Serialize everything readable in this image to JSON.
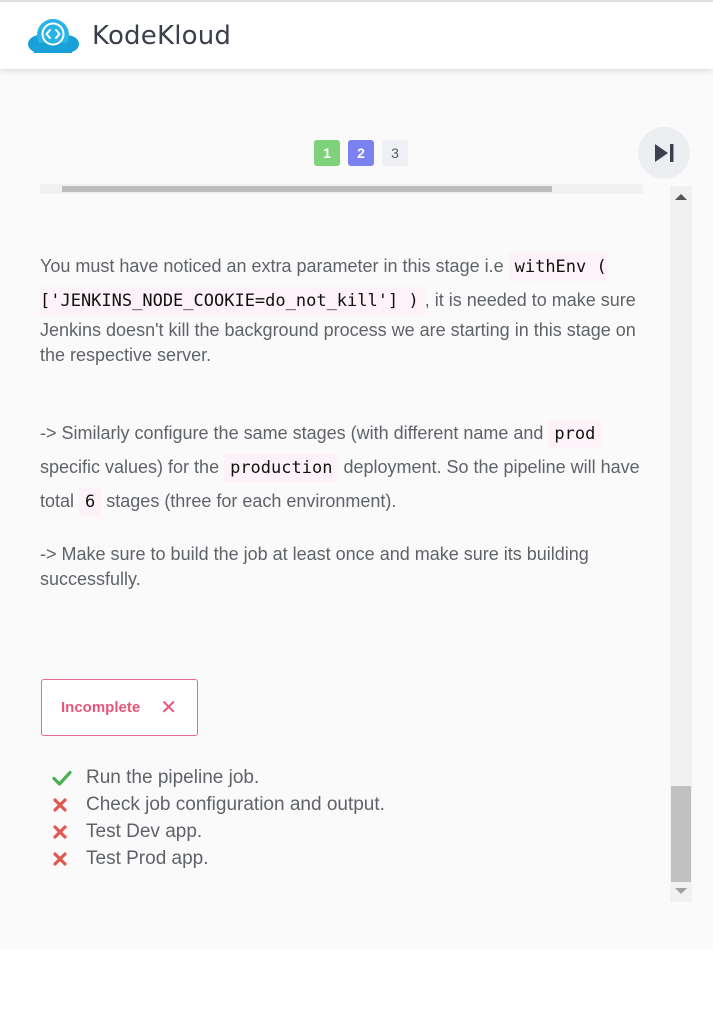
{
  "app": {
    "brand": "KodeKloud",
    "logo_color": "#1fa3dc"
  },
  "pager": {
    "pages": [
      "1",
      "2",
      "3"
    ],
    "current": "2",
    "completed_color": "#7ed27a",
    "current_color": "#7b82f0"
  },
  "content": {
    "p1": {
      "text_before": "You must have noticed an extra parameter in this stage i.e ",
      "code": "withEnv ( ['JENKINS_NODE_COOKIE=do_not_kill'] )",
      "text_after": ", it is needed to make sure Jenkins doesn't kill the background process we are starting in this stage on the respective server."
    },
    "p2": {
      "t1": "-> Similarly configure the same stages (with different name and ",
      "c1": "prod",
      "t2": " specific values) for the ",
      "c2": "production",
      "t3": " deployment. So the pipeline will have total ",
      "c3": "6",
      "t4": " stages (three for each environment)."
    },
    "p3": "-> Make sure to build the job at least once and make sure its building successfully."
  },
  "status": {
    "label": "Incomplete",
    "color": "#e8557a"
  },
  "checks": [
    {
      "label": "Run the pipeline job.",
      "passed": true
    },
    {
      "label": "Check job configuration and output.",
      "passed": false
    },
    {
      "label": "Test Dev app.",
      "passed": false
    },
    {
      "label": "Test Prod app.",
      "passed": false
    }
  ],
  "colors": {
    "pass": "#4caf50",
    "fail": "#e4574f"
  }
}
